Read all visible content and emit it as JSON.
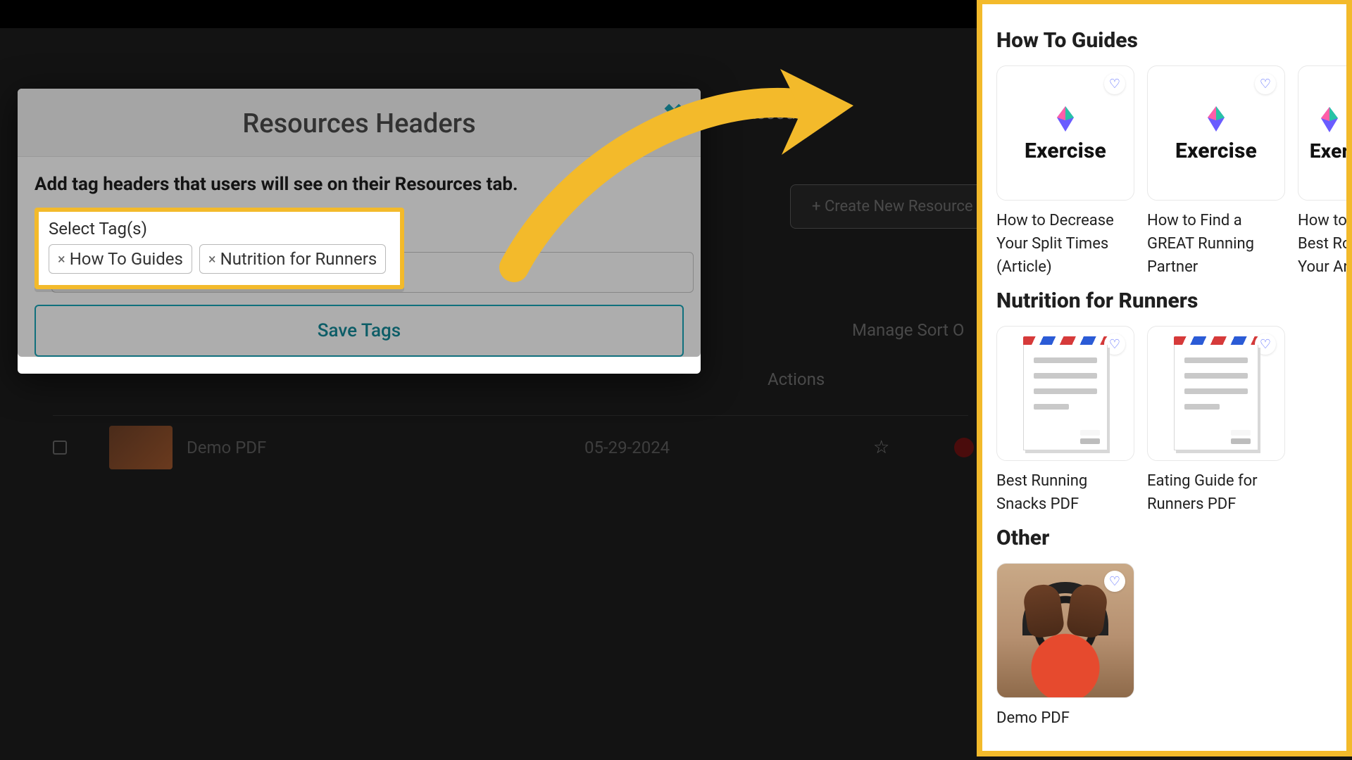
{
  "background": {
    "account_label": "Account",
    "create_button": "+  Create New Resource",
    "manage_sort": "Manage Sort O",
    "actions_header": "Actions",
    "row": {
      "name": "Demo PDF",
      "date": "05-29-2024"
    }
  },
  "modal": {
    "title": "Resources Headers",
    "description": "Add tag headers that users will see on their Resources tab.",
    "select_label": "Select Tag(s)",
    "tags": [
      "How To Guides",
      "Nutrition for Runners"
    ],
    "save_label": "Save Tags"
  },
  "preview": {
    "sections": [
      {
        "title": "How To Guides",
        "type": "exercise",
        "cards": [
          {
            "title": "How to Decrease Your Split Times (Article)",
            "logo": "Exercise"
          },
          {
            "title": "How to Find a GREAT Running Partner",
            "logo": "Exercise"
          },
          {
            "title": "How to F\nBest Rou\nYour Are",
            "logo": "Exer",
            "cut": true
          }
        ]
      },
      {
        "title": "Nutrition for Runners",
        "type": "doc",
        "cards": [
          {
            "title": "Best Running Snacks PDF"
          },
          {
            "title": "Eating Guide for Runners PDF"
          }
        ]
      },
      {
        "title": "Other",
        "type": "image",
        "cards": [
          {
            "title": "Demo PDF"
          }
        ]
      }
    ]
  }
}
